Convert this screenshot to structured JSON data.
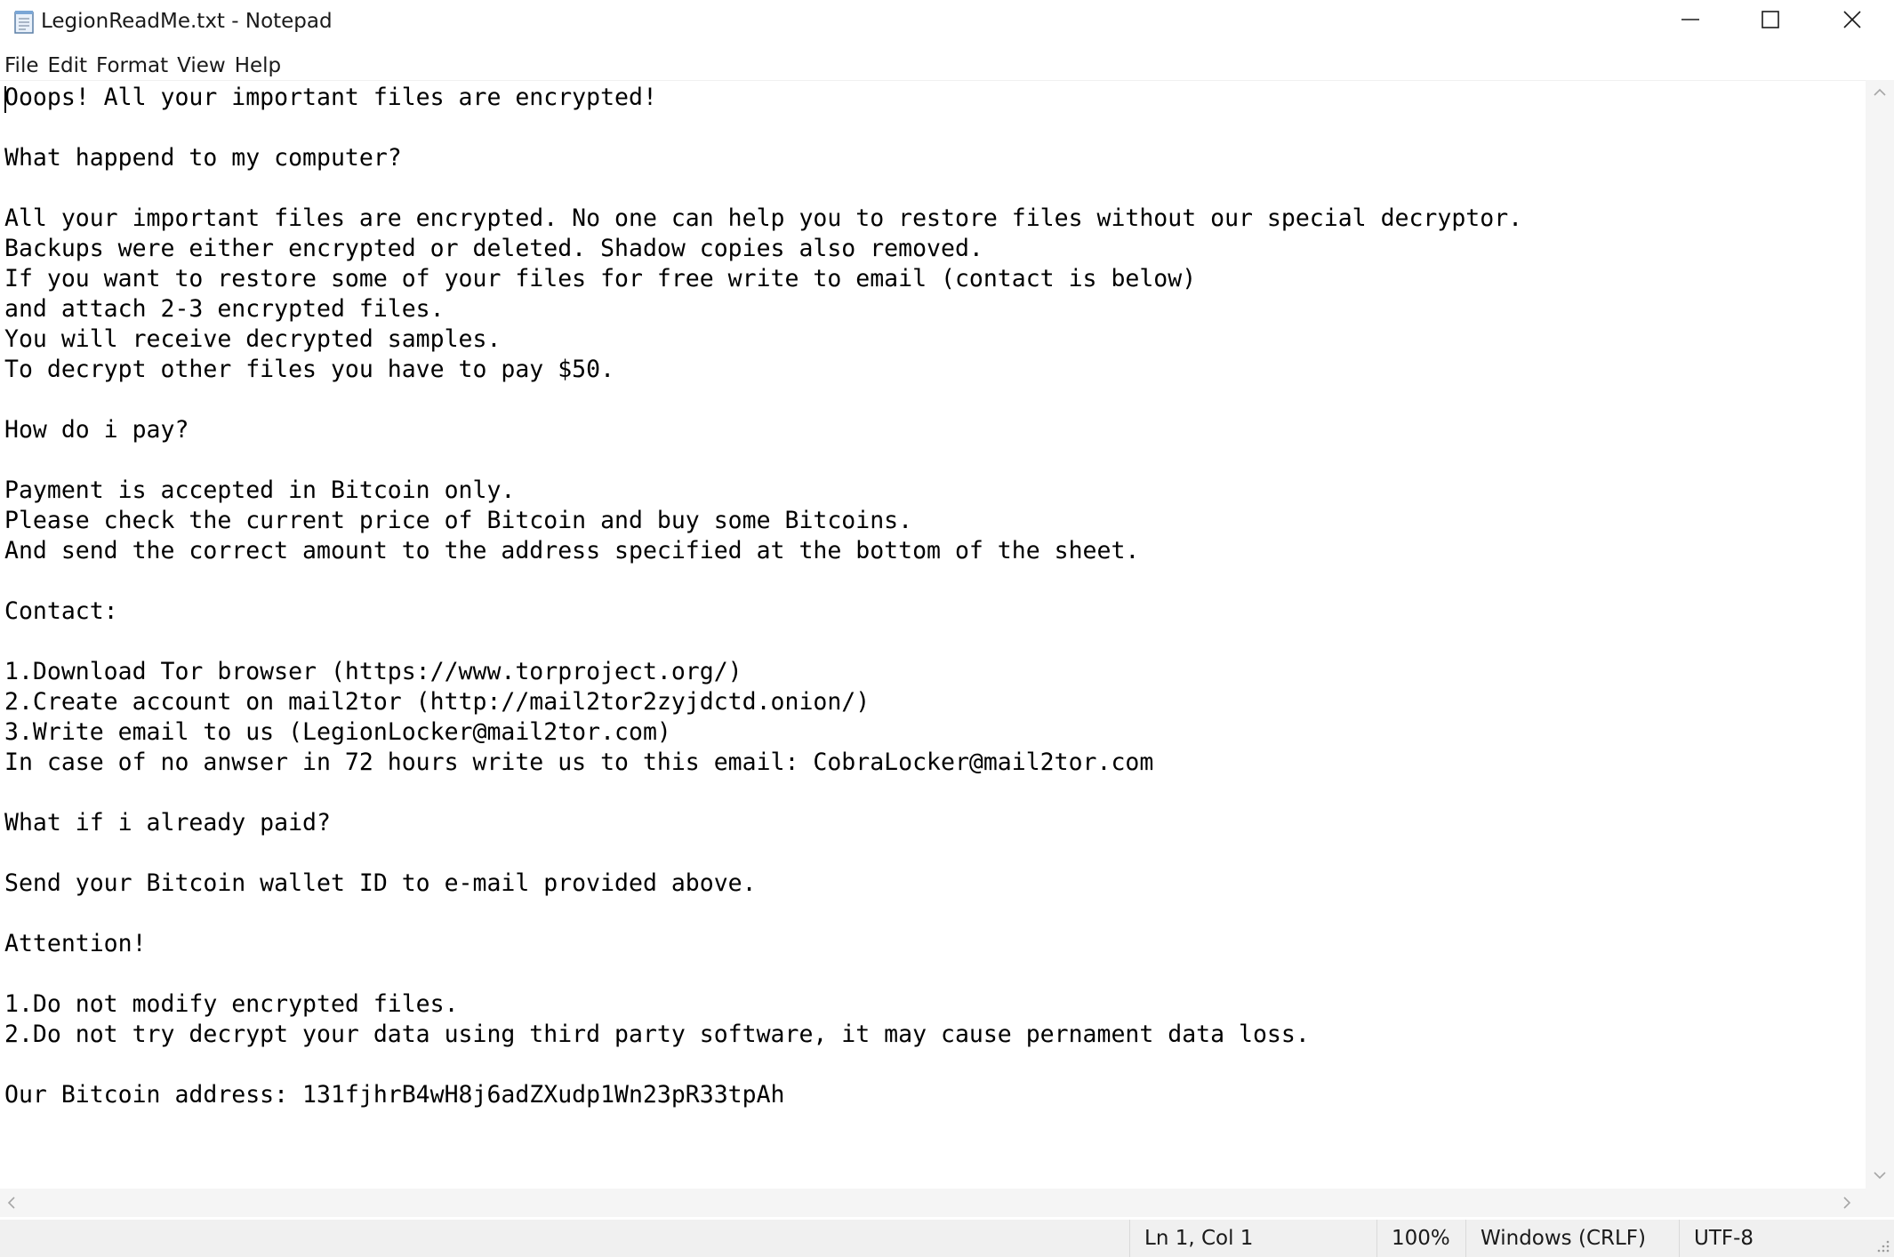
{
  "window": {
    "title": "LegionReadMe.txt - Notepad",
    "app_icon": "notepad-icon",
    "controls": [
      "minimize-icon",
      "maximize-icon",
      "close-icon"
    ]
  },
  "menu": {
    "items": [
      "File",
      "Edit",
      "Format",
      "View",
      "Help"
    ]
  },
  "document": {
    "lines": [
      "Ooops! All your important files are encrypted!",
      "",
      "What happend to my computer?",
      "",
      "All your important files are encrypted. No one can help you to restore files without our special decryptor.",
      "Backups were either encrypted or deleted. Shadow copies also removed.",
      "If you want to restore some of your files for free write to email (contact is below)",
      "and attach 2-3 encrypted files.",
      "You will receive decrypted samples.",
      "To decrypt other files you have to pay $50.",
      "",
      "How do i pay?",
      "",
      "Payment is accepted in Bitcoin only.",
      "Please check the current price of Bitcoin and buy some Bitcoins.",
      "And send the correct amount to the address specified at the bottom of the sheet.",
      "",
      "Contact:",
      "",
      "1.Download Tor browser (https://www.torproject.org/)",
      "2.Create account on mail2tor (http://mail2tor2zyjdctd.onion/)",
      "3.Write email to us (LegionLocker@mail2tor.com)",
      "In case of no anwser in 72 hours write us to this email: CobraLocker@mail2tor.com",
      "",
      "What if i already paid?",
      "",
      "Send your Bitcoin wallet ID to e-mail provided above.",
      "",
      "Attention!",
      "",
      "1.Do not modify encrypted files.",
      "2.Do not try decrypt your data using third party software, it may cause pernament data loss.",
      "",
      "Our Bitcoin address: 131fjhrB4wH8j6adZXudp1Wn23pR33tpAh"
    ]
  },
  "status": {
    "position": "Ln 1, Col 1",
    "zoom": "100%",
    "line_endings": "Windows (CRLF)",
    "encoding": "UTF-8"
  },
  "colors": {
    "status_bg": "#f0f0f0",
    "scrollbar_bg": "#f5f5f5",
    "text": "#000000"
  }
}
